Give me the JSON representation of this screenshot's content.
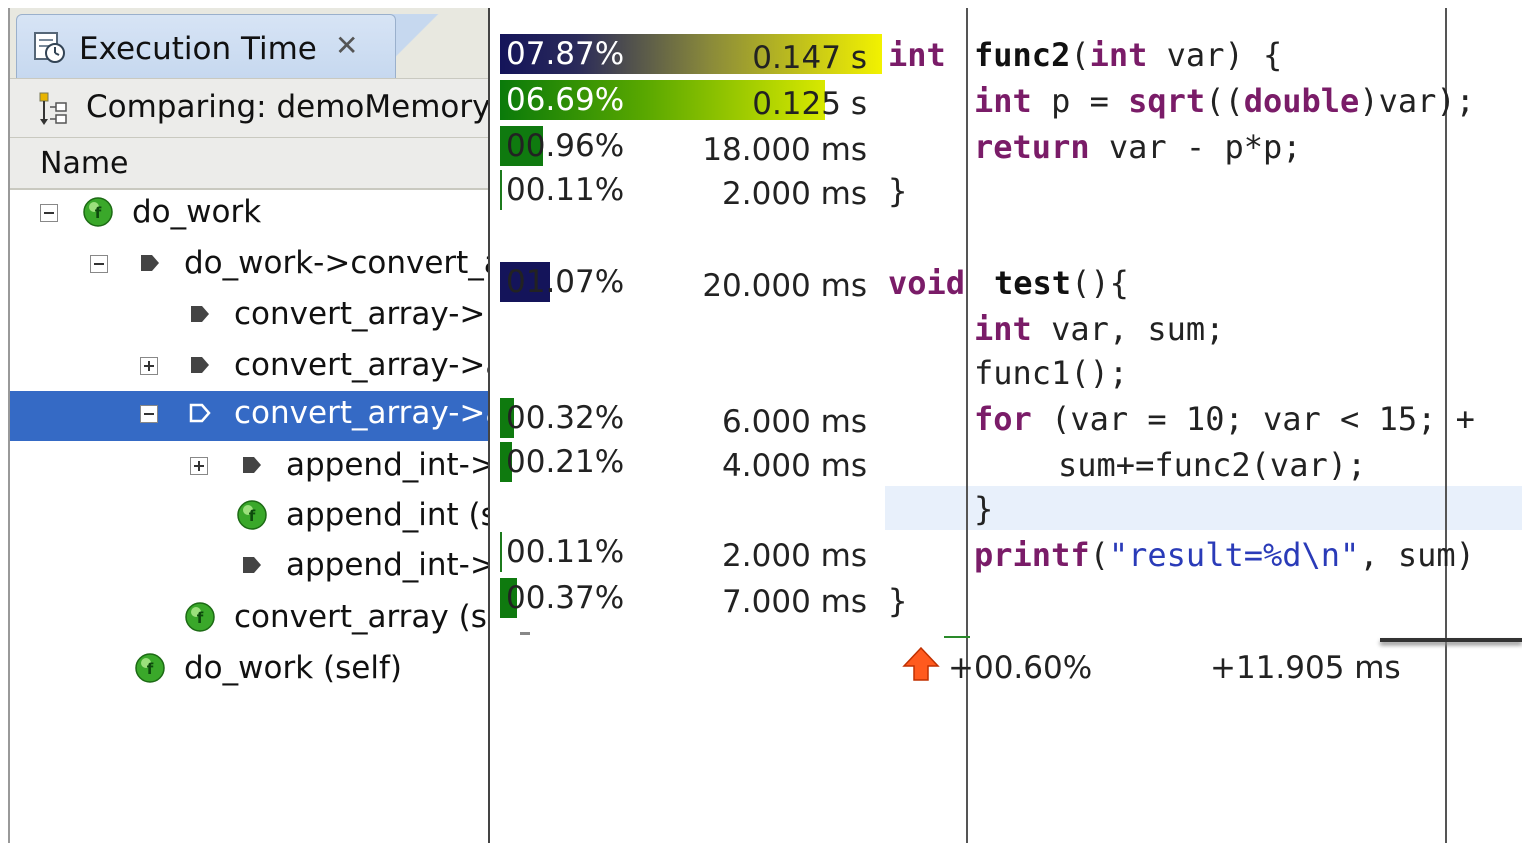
{
  "tab": {
    "title": "Execution Time",
    "close": "✕"
  },
  "comparison": {
    "label": "Comparing: demoMemoryI"
  },
  "tree": {
    "header": "Name",
    "rows": [
      {
        "label": "do_work",
        "icon": "function-green-icon",
        "expander": "minus",
        "selected": false
      },
      {
        "label": "do_work->convert_a",
        "icon": "call-arrow-icon",
        "expander": "minus",
        "selected": false
      },
      {
        "label": "convert_array->i",
        "icon": "call-arrow-icon",
        "expander": "",
        "selected": false
      },
      {
        "label": "convert_array->a",
        "icon": "call-arrow-icon",
        "expander": "plus",
        "selected": false
      },
      {
        "label": "convert_array->a",
        "icon": "call-arrow-outline-icon",
        "expander": "minus",
        "selected": true
      },
      {
        "label": "append_int->",
        "icon": "call-arrow-icon",
        "expander": "plus",
        "selected": false
      },
      {
        "label": "append_int (s",
        "icon": "function-green-icon",
        "expander": "",
        "selected": false
      },
      {
        "label": "append_int->",
        "icon": "call-arrow-icon",
        "expander": "",
        "selected": false
      },
      {
        "label": "convert_array (se",
        "icon": "function-green-icon",
        "expander": "",
        "selected": false
      },
      {
        "label": "do_work (self)",
        "icon": "function-green-icon",
        "expander": "",
        "selected": false
      }
    ]
  },
  "metrics": [
    {
      "pct": "07.87%",
      "time": "0.147  s",
      "fill": 0.0787,
      "style": "navy-yellow"
    },
    {
      "pct": "06.69%",
      "time": "0.125  s",
      "fill": 0.0669,
      "style": "green-yellow"
    },
    {
      "pct": "00.96%",
      "time": "18.000 ms",
      "fill": 0.0096,
      "style": "green"
    },
    {
      "pct": "00.11%",
      "time": "2.000 ms",
      "fill": 0.0011,
      "style": "thin"
    },
    {
      "pct": "01.07%",
      "time": "20.000 ms",
      "fill": 0.0107,
      "style": "navy"
    },
    {
      "pct": "00.32%",
      "time": "6.000 ms",
      "fill": 0.0032,
      "style": "green"
    },
    {
      "pct": "00.21%",
      "time": "4.000 ms",
      "fill": 0.0021,
      "style": "green"
    },
    {
      "pct": "00.11%",
      "time": "2.000 ms",
      "fill": 0.0011,
      "style": "thin"
    },
    {
      "pct": "00.37%",
      "time": "7.000 ms",
      "fill": 0.0037,
      "style": "green"
    }
  ],
  "code": {
    "l1_kw": "int",
    "l1_fn": "func2",
    "l1_p1": "(",
    "l1_kw2": "int",
    "l1_rest": " var) {",
    "l2_kw": "int",
    "l2_mid": " p = ",
    "l2_fn": "sqrt",
    "l2_p": "((",
    "l2_kw2": "double",
    "l2_rest": ")var);",
    "l3_kw": "return",
    "l3_rest": " var - p*p;",
    "l4": "}",
    "l5_kw": "void",
    "l5_fn": "test",
    "l5_rest": "(){",
    "l6_kw": "int",
    "l6_rest": " var, sum;",
    "l7": "func1();",
    "l8_kw": "for",
    "l8_rest": " (var = 10; var < 15; +",
    "l9": "sum+=func2(var);",
    "l10": "}",
    "l11_kw": "printf",
    "l11_p": "(",
    "l11_str": "\"result=%d\\n\"",
    "l11_rest": ", sum)",
    "l12": "}"
  },
  "summary": {
    "pct": "+00.60%",
    "time": "+11.905 ms"
  }
}
